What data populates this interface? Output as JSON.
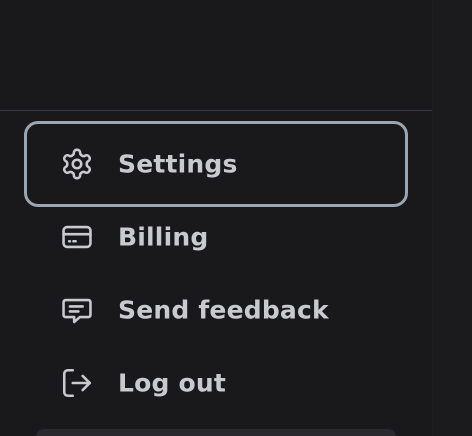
{
  "menu": {
    "items": [
      {
        "label": "Settings",
        "icon": "gear-icon",
        "focused": true
      },
      {
        "label": "Billing",
        "icon": "credit-card-icon",
        "focused": false
      },
      {
        "label": "Send feedback",
        "icon": "message-icon",
        "focused": false
      },
      {
        "label": "Log out",
        "icon": "log-out-icon",
        "focused": false
      }
    ]
  },
  "colors": {
    "background": "#19191b",
    "text": "#c9c9d0",
    "focus_ring": "#9ba6b0",
    "divider": "#3b3b3f"
  }
}
